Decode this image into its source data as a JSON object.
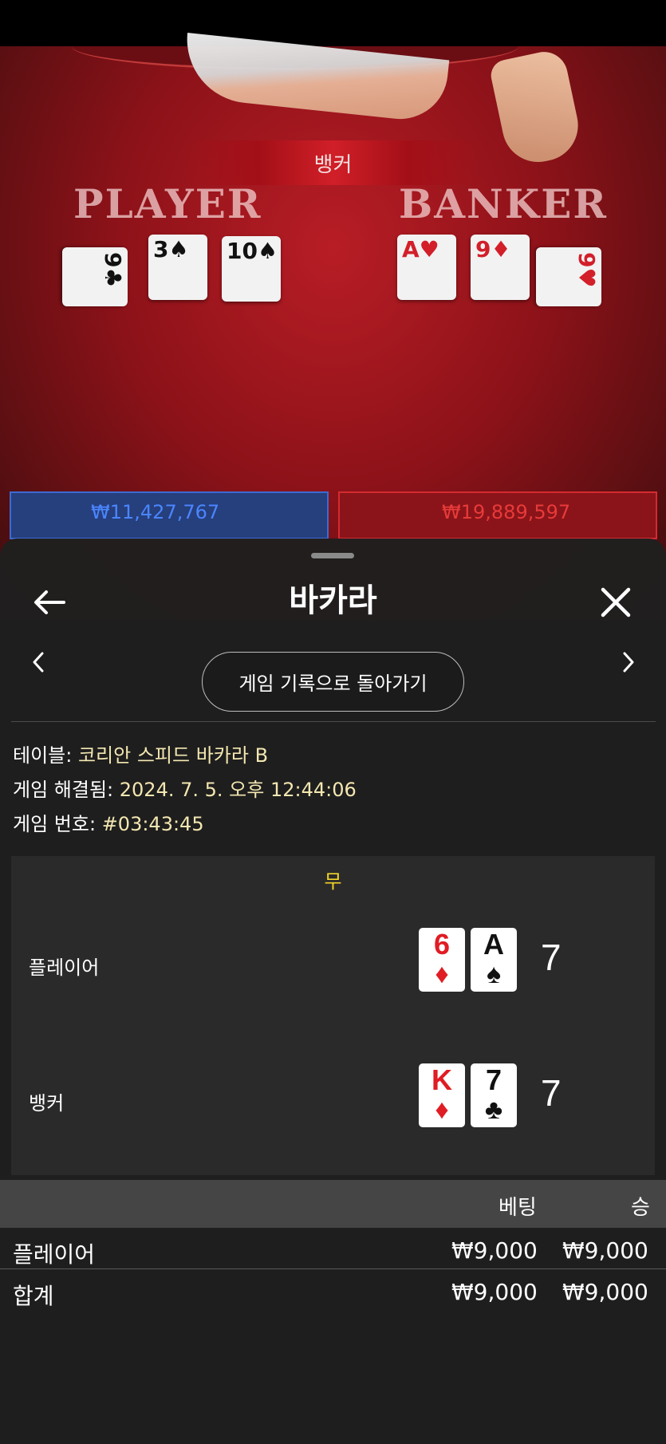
{
  "scene": {
    "banner_label": "뱅커",
    "player_label": "PLAYER",
    "banker_label": "BANKER",
    "player_cards": [
      {
        "rank": "9",
        "suit": "♣",
        "color": "black"
      },
      {
        "rank": "3",
        "suit": "♠",
        "color": "black"
      },
      {
        "rank": "10",
        "suit": "♠",
        "color": "black"
      }
    ],
    "banker_cards": [
      {
        "rank": "A",
        "suit": "♥",
        "color": "red"
      },
      {
        "rank": "9",
        "suit": "♦",
        "color": "red"
      },
      {
        "rank": "9",
        "suit": "♥",
        "color": "red"
      }
    ],
    "player_total_amount": "₩11,427,767",
    "banker_total_amount": "₩19,889,597"
  },
  "sheet": {
    "title": "바카라",
    "history_button": "게임 기록으로 돌아가기",
    "info": {
      "table_label": "테이블:",
      "table_value": "코리안 스피드 바카라 B",
      "resolved_label": "게임 해결됨:",
      "resolved_value": "2024. 7. 5. 오후 12:44:06",
      "round_label": "게임 번호:",
      "round_value": "#03:43:45"
    },
    "result": {
      "outcome": "무",
      "player": {
        "label": "플레이어",
        "cards": [
          {
            "rank": "6",
            "suit": "♦",
            "color": "red"
          },
          {
            "rank": "A",
            "suit": "♠",
            "color": "black"
          }
        ],
        "score": "7"
      },
      "banker": {
        "label": "뱅커",
        "cards": [
          {
            "rank": "K",
            "suit": "♦",
            "color": "red"
          },
          {
            "rank": "7",
            "suit": "♣",
            "color": "black"
          }
        ],
        "score": "7"
      }
    },
    "bets_table": {
      "col_bet": "베팅",
      "col_win": "승",
      "rows": [
        {
          "name": "플레이어",
          "bet": "₩9,000",
          "win": "₩9,000"
        }
      ],
      "total": {
        "name": "합계",
        "bet": "₩9,000",
        "win": "₩9,000"
      }
    }
  },
  "colors": {
    "accent_gold": "#f2d32a",
    "info_value": "#f3e7b1",
    "card_red": "#e01c24"
  }
}
